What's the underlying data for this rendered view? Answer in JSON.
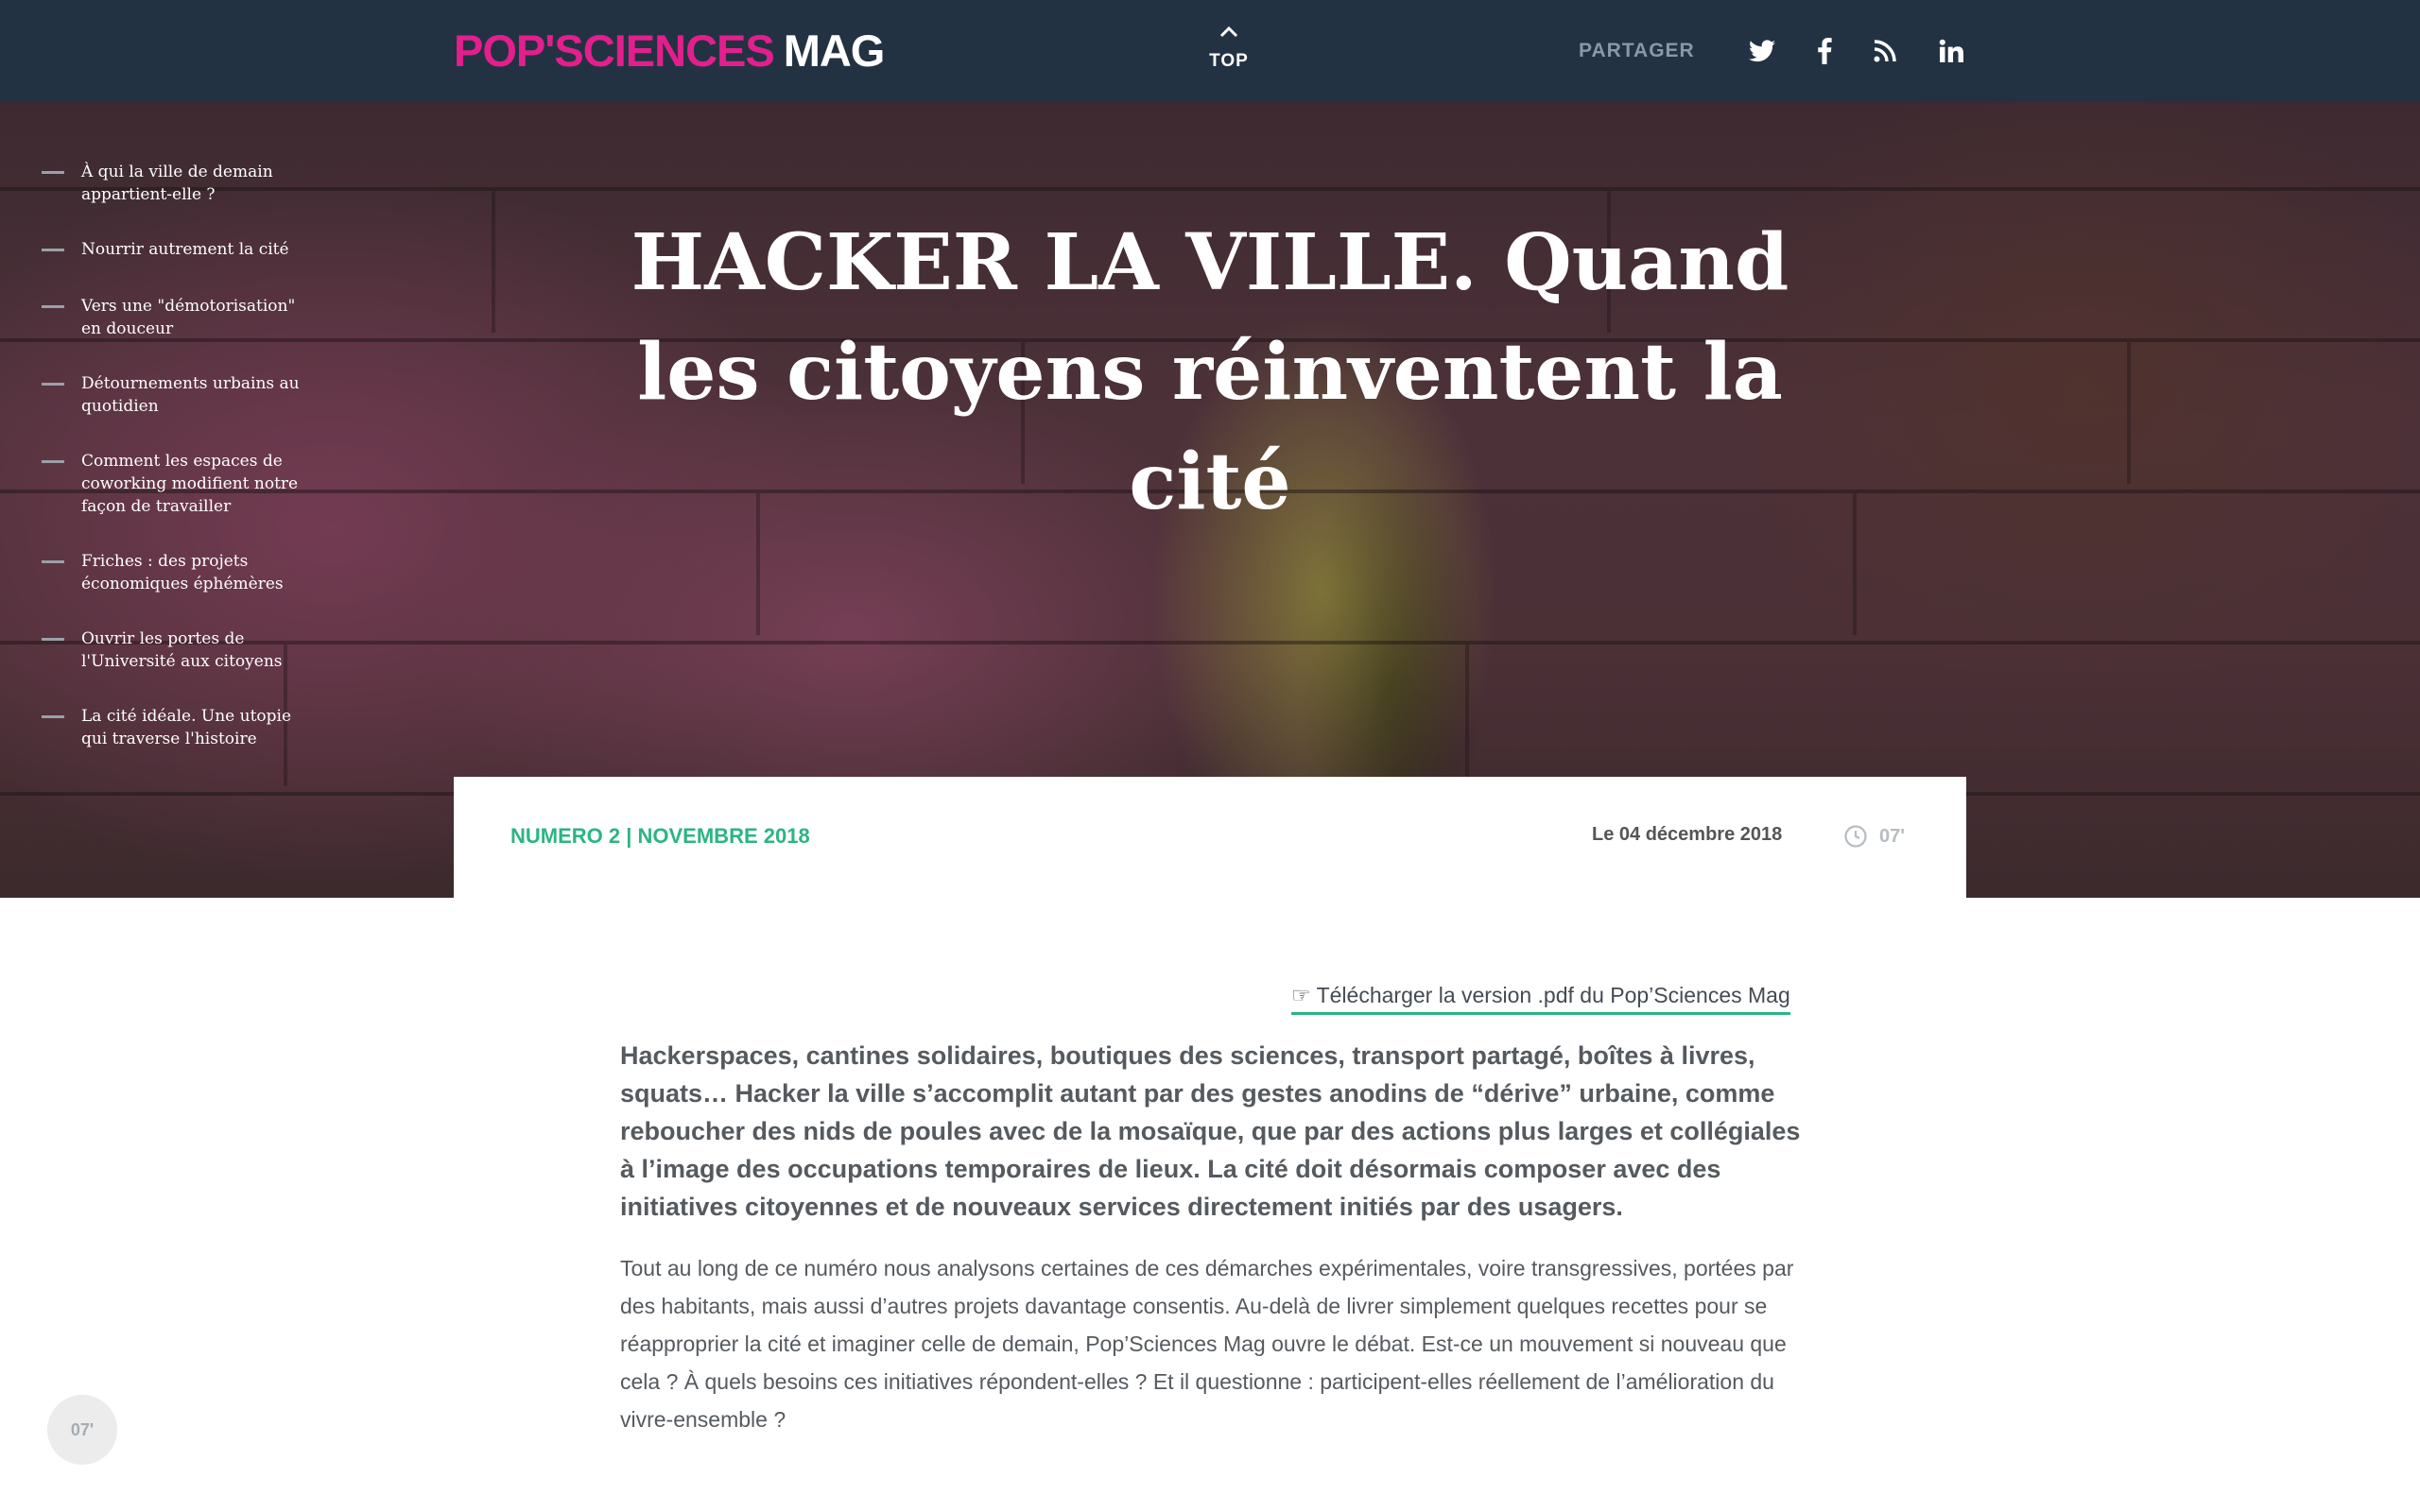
{
  "header": {
    "logo_pop": "POP'SCIENCES",
    "logo_mag": "MAG",
    "top_label": "TOP",
    "share_label": "PARTAGER",
    "social_icons": [
      "twitter-icon",
      "facebook-icon",
      "rss-icon",
      "linkedin-icon"
    ]
  },
  "hero": {
    "title": "HACKER LA VILLE. Quand les citoyens réinventent la cité"
  },
  "toc": {
    "items": [
      "À qui la ville de demain appartient-elle ?",
      "Nourrir autrement la cité",
      "Vers une \"démotorisation\" en douceur",
      "Détournements urbains au quotidien",
      "Comment les espaces de coworking modifient notre façon de travailler",
      "Friches : des projets économiques éphémères",
      "Ouvrir les portes de l'Université aux citoyens",
      "La cité idéale. Une utopie qui traverse l'histoire"
    ]
  },
  "meta": {
    "issue": "NUMERO 2 | NOVEMBRE 2018",
    "date": "Le 04 décembre 2018",
    "read_time": "07'"
  },
  "article": {
    "pdf_link": "☞ Télécharger la version .pdf du Pop’Sciences Mag",
    "lead": "Hackerspaces, cantines solidaires, boutiques des sciences, transport partagé, boîtes à livres, squats… Hacker la ville s’accomplit autant par des gestes anodins de “dérive” urbaine, comme reboucher des nids de poules avec de la mosaïque, que par des actions plus larges et collégiales à l’image des occupations temporaires de lieux. La cité doit désormais composer avec des initiatives citoyennes et de nouveaux services directement initiés par des usagers.",
    "body": "Tout au long de ce numéro nous analysons certaines de ces démarches expérimentales, voire transgressives, portées par des habitants, mais aussi d’autres projets davantage consentis. Au-delà de livrer simplement quelques recettes pour se réapproprier la cité et imaginer celle de demain, Pop’Sciences Mag ouvre le débat. Est-ce un mouvement si nouveau que cela ? À quels besoins ces initiatives répondent-elles ?  Et il questionne : participent-elles réellement de l’amélioration du vivre-ensemble ?"
  },
  "floating": {
    "read_time": "07'"
  },
  "colors": {
    "header_bg": "#233242",
    "brand_pink": "#e31f8d",
    "accent_green": "#2bb582"
  }
}
